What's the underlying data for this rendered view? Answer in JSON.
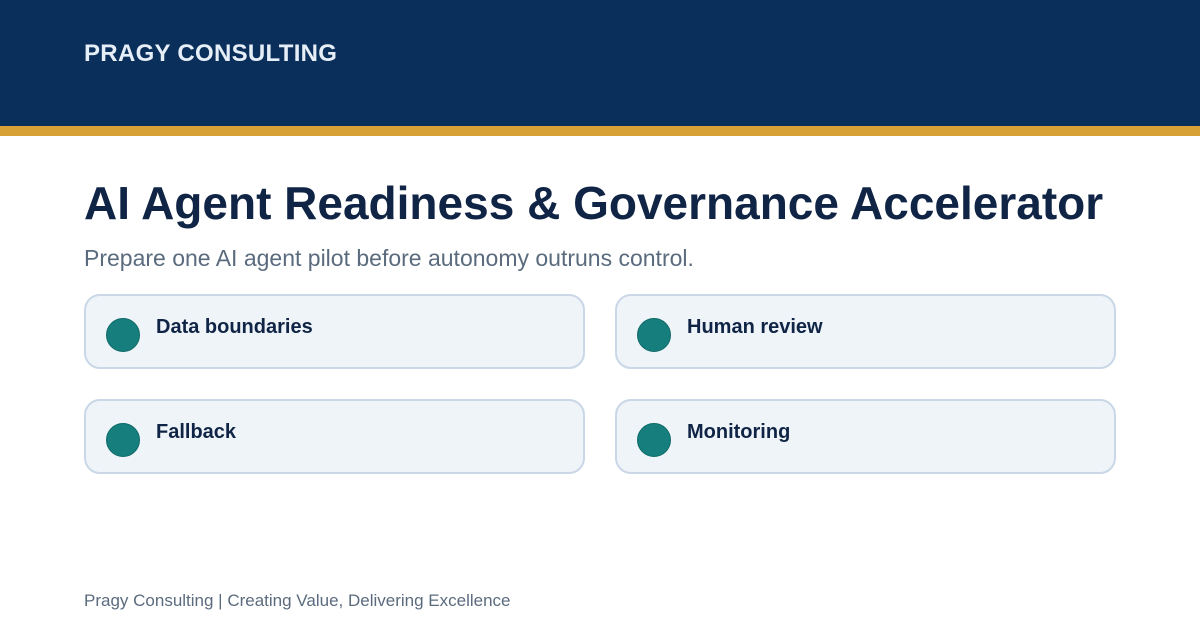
{
  "header": {
    "brand": "PRAGY CONSULTING"
  },
  "main": {
    "title": "AI Agent Readiness & Governance Accelerator",
    "subtitle": "Prepare one AI agent pilot before autonomy outruns control.",
    "cards": [
      {
        "label": "Data boundaries",
        "icon": "circle-bullet-icon"
      },
      {
        "label": "Human review",
        "icon": "circle-bullet-icon"
      },
      {
        "label": "Fallback",
        "icon": "circle-bullet-icon"
      },
      {
        "label": "Monitoring",
        "icon": "circle-bullet-icon"
      }
    ]
  },
  "footer": {
    "text": "Pragy Consulting | Creating Value, Delivering Excellence"
  },
  "colors": {
    "header_bg": "#0b2f5b",
    "accent": "#d7a136",
    "title": "#102545",
    "muted_text": "#5b6b7e",
    "card_bg": "#eff4f9",
    "card_border": "#c9d7e6",
    "bullet": "#167f7d"
  }
}
